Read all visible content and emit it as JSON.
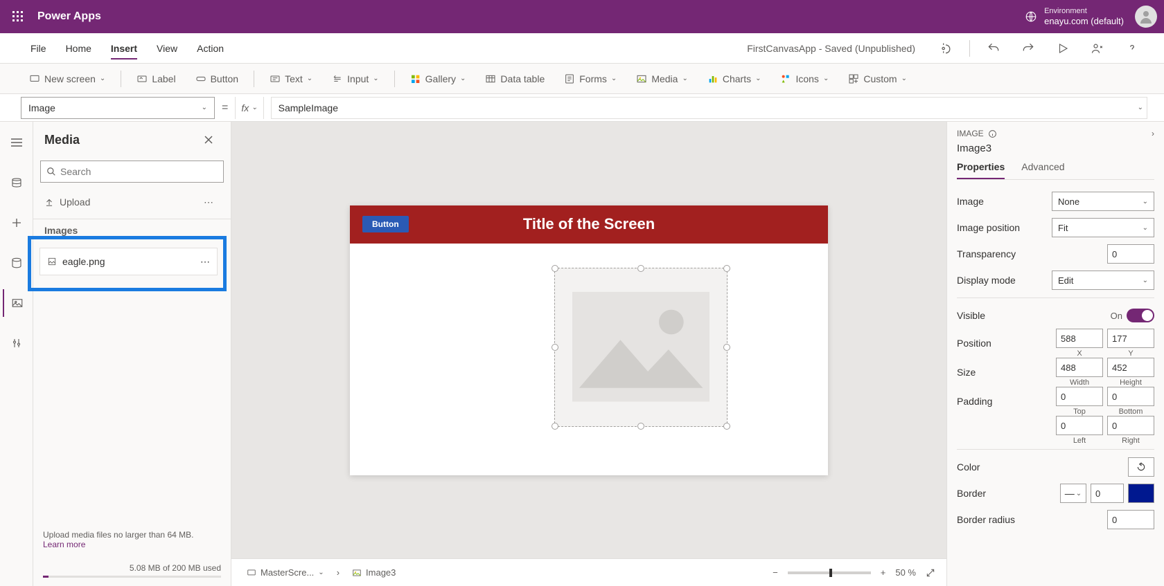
{
  "header": {
    "app_title": "Power Apps",
    "env_label": "Environment",
    "env_name": "enayu.com (default)"
  },
  "menubar": {
    "items": [
      "File",
      "Home",
      "Insert",
      "View",
      "Action"
    ],
    "active_index": 2,
    "status": "FirstCanvasApp - Saved (Unpublished)"
  },
  "ribbon": {
    "new_screen": "New screen",
    "label": "Label",
    "button": "Button",
    "text": "Text",
    "input": "Input",
    "gallery": "Gallery",
    "data_table": "Data table",
    "forms": "Forms",
    "media": "Media",
    "charts": "Charts",
    "icons": "Icons",
    "custom": "Custom"
  },
  "formula": {
    "property": "Image",
    "value": "SampleImage"
  },
  "media_panel": {
    "title": "Media",
    "search_placeholder": "Search",
    "upload": "Upload",
    "section": "Images",
    "file": "eagle.png",
    "footer_text": "Upload media files no larger than 64 MB.",
    "learn_more": "Learn more",
    "storage_text": "5.08 MB of 200 MB used"
  },
  "canvas": {
    "button_label": "Button",
    "screen_title": "Title of the Screen",
    "breadcrumb_screen": "MasterScre...",
    "breadcrumb_control": "Image3",
    "zoom": "50  %"
  },
  "properties": {
    "type_label": "IMAGE",
    "control_name": "Image3",
    "tabs": [
      "Properties",
      "Advanced"
    ],
    "image_label": "Image",
    "image_value": "None",
    "image_position_label": "Image position",
    "image_position_value": "Fit",
    "transparency_label": "Transparency",
    "transparency_value": "0",
    "display_mode_label": "Display mode",
    "display_mode_value": "Edit",
    "visible_label": "Visible",
    "visible_value": "On",
    "position_label": "Position",
    "position_x": "588",
    "position_y": "177",
    "x_label": "X",
    "y_label": "Y",
    "size_label": "Size",
    "size_w": "488",
    "size_h": "452",
    "w_label": "Width",
    "h_label": "Height",
    "padding_label": "Padding",
    "pad_top": "0",
    "pad_bottom": "0",
    "pad_left": "0",
    "pad_right": "0",
    "top_label": "Top",
    "bottom_label": "Bottom",
    "left_label": "Left",
    "right_label": "Right",
    "color_label": "Color",
    "border_label": "Border",
    "border_value": "0",
    "border_radius_label": "Border radius",
    "border_radius_value": "0"
  }
}
